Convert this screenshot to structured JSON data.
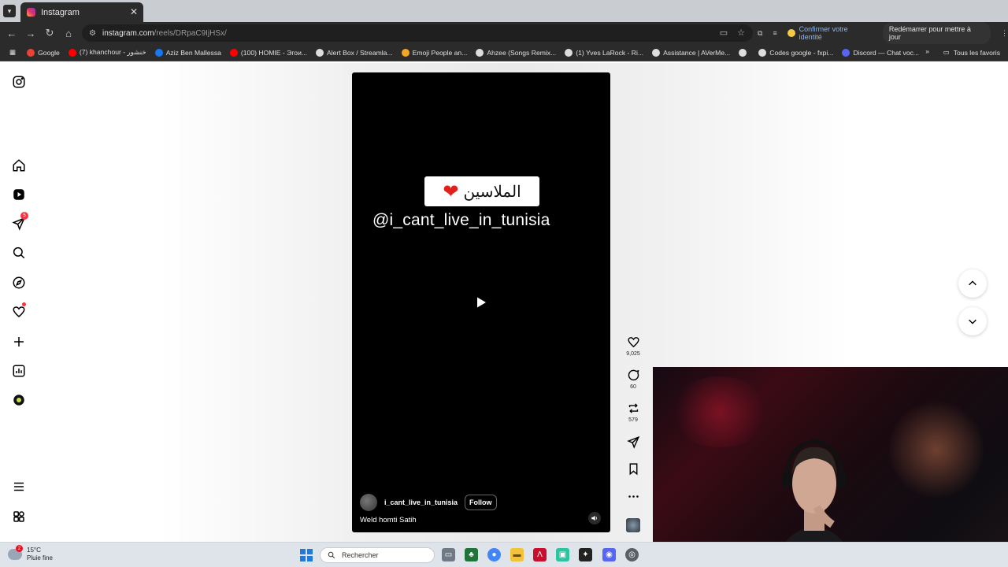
{
  "browser": {
    "tab_title": "Instagram",
    "url_host": "instagram.com",
    "url_path": "/reels/DRpaC9IjHSx/",
    "confirm_identity": "Confirmer votre identité",
    "restart_label": "Redémarrer pour mettre à jour",
    "bookmarks": [
      {
        "label": "Google",
        "color": "#ea4335"
      },
      {
        "label": "(7) khanchour - خنشور",
        "color": "#ff0000"
      },
      {
        "label": "Aziz Ben Mallessa",
        "color": "#1877f2"
      },
      {
        "label": "(100) HOMIE - Эгои...",
        "color": "#ff0000"
      },
      {
        "label": "Alert Box / Streamla...",
        "color": "#dddddd"
      },
      {
        "label": "Emoji People an...",
        "color": "#f4a623"
      },
      {
        "label": "Ahzee (Songs Remix...",
        "color": "#dddddd"
      },
      {
        "label": "(1) Yves LaRock - Ri...",
        "color": "#dddddd"
      },
      {
        "label": "Assistance | AVerMe...",
        "color": "#dddddd"
      },
      {
        "label": "",
        "color": "#dddddd"
      },
      {
        "label": "Codes google - fxpi...",
        "color": "#dddddd"
      },
      {
        "label": "Discord — Chat voc...",
        "color": "#5865f2"
      }
    ],
    "all_bookmarks": "Tous les favoris"
  },
  "sidebar": {
    "notification_count": "5"
  },
  "reel": {
    "overlay_arabic": "الملاسين",
    "overlay_emoji": "❤",
    "overlay_handle": "@i_cant_live_in_tunisia",
    "author": "i_cant_live_in_tunisia",
    "follow_label": "Follow",
    "caption": "Weld homti Satih",
    "likes": "9,025",
    "comments": "60",
    "reposts": "579"
  },
  "taskbar": {
    "temperature": "15°C",
    "weather_desc": "Pluie fine",
    "weather_badge": "2",
    "search_placeholder": "Rechercher"
  },
  "colors": {
    "instagram_gradient": [
      "#fcaf45",
      "#e1306c",
      "#833ab4"
    ],
    "notification_red": "#ff3040",
    "link_blue": "#8ab4f8"
  }
}
